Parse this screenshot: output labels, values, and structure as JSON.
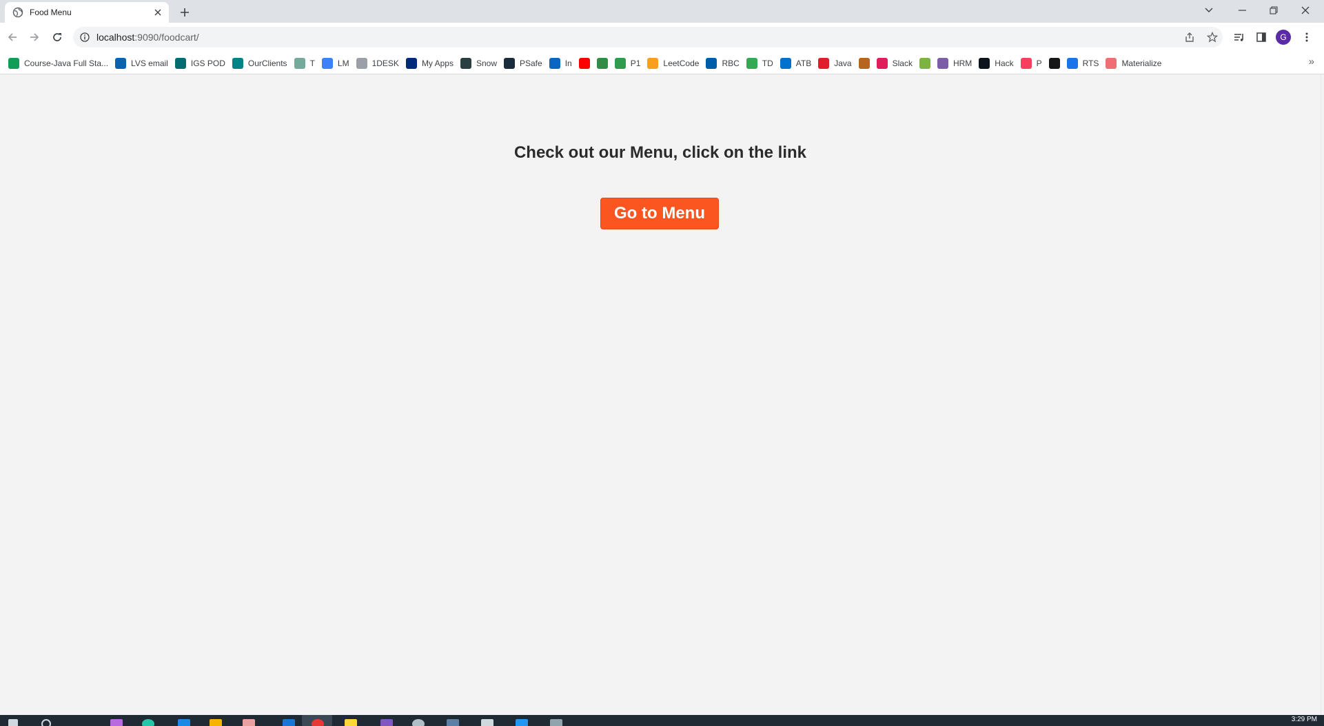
{
  "browser": {
    "tab_title": "Food Menu",
    "url_host": "localhost",
    "url_path": ":9090/foodcart/",
    "avatar_letter": "G",
    "colors": {
      "tabstrip": "#dee1e6",
      "avatar": "#5b2aa6"
    }
  },
  "bookmarks": [
    {
      "label": "Course-Java Full Sta...",
      "icon": "sheets-icon",
      "color": "#0f9d58"
    },
    {
      "label": "LVS email",
      "icon": "outlook-icon",
      "color": "#0a64ad"
    },
    {
      "label": "IGS POD",
      "icon": "sharepoint-icon",
      "color": "#036c70"
    },
    {
      "label": "OurClients",
      "icon": "sharepoint-icon",
      "color": "#038387"
    },
    {
      "label": "T",
      "icon": "openai-icon",
      "color": "#74aa9c"
    },
    {
      "label": "LM",
      "icon": "pulse-icon",
      "color": "#3b82f6"
    },
    {
      "label": "1DESK",
      "icon": "desk-icon",
      "color": "#9aa0a6"
    },
    {
      "label": "My Apps",
      "icon": "okta-icon",
      "color": "#00297a"
    },
    {
      "label": "Snow",
      "icon": "servicenow-icon",
      "color": "#293e40"
    },
    {
      "label": "PSafe",
      "icon": "psafe-icon",
      "color": "#1a2b3c"
    },
    {
      "label": "In",
      "icon": "linkedin-icon",
      "color": "#0a66c2"
    },
    {
      "label": "",
      "icon": "youtube-icon",
      "color": "#ff0000"
    },
    {
      "label": "",
      "icon": "geeks-icon",
      "color": "#2f8d46"
    },
    {
      "label": "P1",
      "icon": "w-icon",
      "color": "#2e9b4f"
    },
    {
      "label": "LeetCode",
      "icon": "leetcode-icon",
      "color": "#f89f1b"
    },
    {
      "label": "RBC",
      "icon": "rbc-icon",
      "color": "#005daa"
    },
    {
      "label": "TD",
      "icon": "td-icon",
      "color": "#34a853"
    },
    {
      "label": "ATB",
      "icon": "atb-icon",
      "color": "#0072ce"
    },
    {
      "label": "Java",
      "icon": "java-icon",
      "color": "#e01e2b"
    },
    {
      "label": "",
      "icon": "shield-icon",
      "color": "#b5651d"
    },
    {
      "label": "Slack",
      "icon": "slack-icon",
      "color": "#e01e5a"
    },
    {
      "label": "",
      "icon": "globe-icon",
      "color": "#7cb342"
    },
    {
      "label": "HRM",
      "icon": "hrm-icon",
      "color": "#7b5ea7"
    },
    {
      "label": "Hack",
      "icon": "hackerrank-icon",
      "color": "#0e141e"
    },
    {
      "label": "P",
      "icon": "play-icon",
      "color": "#f43f5e"
    },
    {
      "label": "",
      "icon": "github-icon",
      "color": "#181717"
    },
    {
      "label": "RTS",
      "icon": "rts-icon",
      "color": "#1a73e8"
    },
    {
      "label": "Materialize",
      "icon": "materialize-icon",
      "color": "#ee6e73"
    }
  ],
  "page": {
    "heading": "Check out our Menu, click on the link",
    "button_label": "Go to Menu",
    "button_color": "#fb5520",
    "background": "#f3f3f3"
  },
  "taskbar": {
    "clock": "3:29 PM"
  }
}
